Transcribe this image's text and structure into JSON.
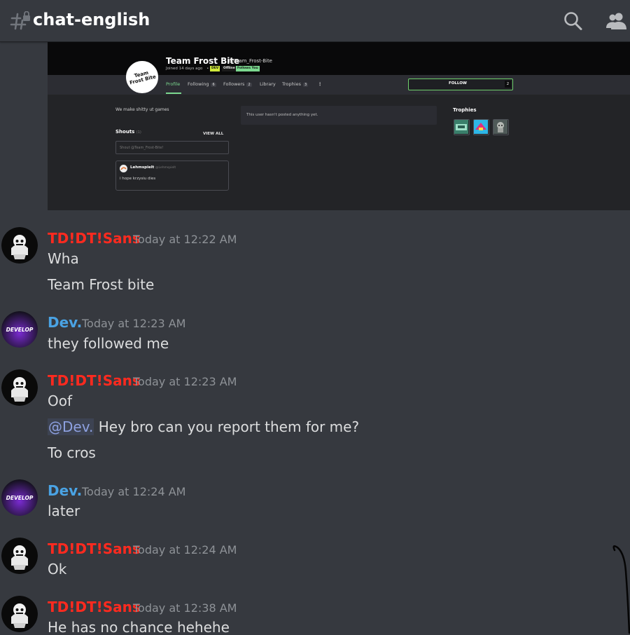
{
  "header": {
    "channel_name": "chat-english",
    "icons": [
      "locked-hash-icon",
      "search-icon",
      "members-icon"
    ]
  },
  "embed": {
    "profile_name": "Team Frost Bite",
    "handle": "@Team_Frost-Bite",
    "joined": "Joined 14 days ago",
    "separator": "•",
    "badges": [
      "DEV",
      "Offline",
      "Follows You"
    ],
    "avatar_text": "Team Frost Bite",
    "tabs": [
      {
        "label": "Profile",
        "count": ""
      },
      {
        "label": "Following",
        "count": "6"
      },
      {
        "label": "Followers",
        "count": "2"
      },
      {
        "label": "Library",
        "count": ""
      },
      {
        "label": "Trophies",
        "count": "3"
      }
    ],
    "more": "⋮",
    "follow_label": "FOLLOW",
    "follow_count": "2",
    "bio": "We make shitty ut games",
    "shouts_title": "Shouts",
    "shouts_count": "(1)",
    "view_all": "VIEW ALL",
    "shout_placeholder": "Shout @Team_Frost-Bite!",
    "shout_author": "Lehmspielt",
    "shout_author_handle": "@Lehmspielt",
    "shout_text": "i hope krzysiu dies",
    "empty_posts": "This user hasn't posted anything yet.",
    "trophies_title": "Trophies",
    "colors": {
      "accent_green": "#7bd88f",
      "follow_border": "#6fcf6b"
    }
  },
  "messages": [
    {
      "author": "TD!DT!Sans",
      "timestamp": "Today at 12:22 AM",
      "lines": [
        "Wha",
        "Team Frost bite"
      ]
    },
    {
      "author": "Dev.",
      "timestamp": "Today at 12:23 AM",
      "lines": [
        "they followed me"
      ]
    },
    {
      "author": "TD!DT!Sans",
      "timestamp": "Today at 12:23 AM",
      "lines": [
        "Oof",
        "Hey bro can you report them for me?",
        "To cros"
      ],
      "mention": "@Dev."
    },
    {
      "author": "Dev.",
      "timestamp": "Today at 12:24 AM",
      "lines": [
        "later"
      ]
    },
    {
      "author": "TD!DT!Sans",
      "timestamp": "Today at 12:24 AM",
      "lines": [
        "Ok"
      ]
    },
    {
      "author": "TD!DT!Sans",
      "timestamp": "Today at 12:38 AM",
      "lines": [
        "He has no chance hehehe"
      ]
    }
  ],
  "avatars": {
    "dev_text": "DEVELOP"
  },
  "colors": {
    "background": "#36393f",
    "sans_name": "#ff2a1f",
    "dev_name": "#4aa3e4",
    "timestamp": "#8e9297",
    "mention": "#8ea1e1"
  }
}
